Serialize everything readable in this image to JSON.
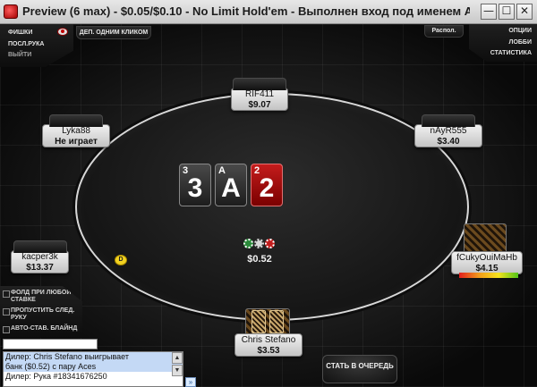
{
  "window": {
    "title": "Preview (6 max) - $0.05/$0.10 - No Limit Hold'em - Выполнен вход под именем Ax...",
    "min_glyph": "—",
    "max_glyph": "☐",
    "close_glyph": "✕"
  },
  "menu_left": {
    "chips": "ФИШКИ",
    "last_hand": "ПОСЛ.РУКА",
    "exit": "ВЫЙТИ"
  },
  "one_click": "ДЕП. ОДНИМ КЛИКОМ",
  "layout_btn": "Распол.",
  "menu_right": {
    "options": "ОПЦИИ",
    "lobby": "ЛОББИ",
    "stats": "СТАТИСТИКА"
  },
  "seats": {
    "top": {
      "name": "RIF411",
      "stack": "$9.07"
    },
    "top_left": {
      "name": "Lyka88",
      "stack": "Не играет"
    },
    "top_right": {
      "name": "nAyR555",
      "stack": "$3.40"
    },
    "left": {
      "name": "kacper3k",
      "stack": "$13.37"
    },
    "right": {
      "name": "fCukyOuiMaHb",
      "stack": "$4.15"
    },
    "hero": {
      "name": "Chris Stefano",
      "stack": "$3.53"
    }
  },
  "board": [
    {
      "rank": "3",
      "corner": "3",
      "color": "#2a2a2a"
    },
    {
      "rank": "A",
      "corner": "A",
      "color": "#2a2a2a"
    },
    {
      "rank": "2",
      "corner": "2",
      "color": "#b01515"
    }
  ],
  "pot": "$0.52",
  "dealer_button": "D",
  "controls": {
    "fold_any": "ФОЛД ПРИ ЛЮБОЙ СТАВКЕ",
    "sit_out": "ПРОПУСТИТЬ СЛЕД. РУКУ",
    "auto_blind": "АВТО-СТАВ. БЛАЙНД"
  },
  "chat": {
    "input_value": "",
    "lines": [
      "Дилер: Chris Stefano выигрывает",
      "банк ($0.52) с пару Aces",
      "Дилер: Рука #18341676250"
    ],
    "scroll_up": "▲",
    "scroll_down": "▼",
    "send": "»"
  },
  "waitlist": "СТАТЬ В ОЧЕРЕДЬ",
  "colors": {
    "table_line": "#d8d8d8",
    "accent_red": "#b01515",
    "dealer": "#f2d221"
  }
}
